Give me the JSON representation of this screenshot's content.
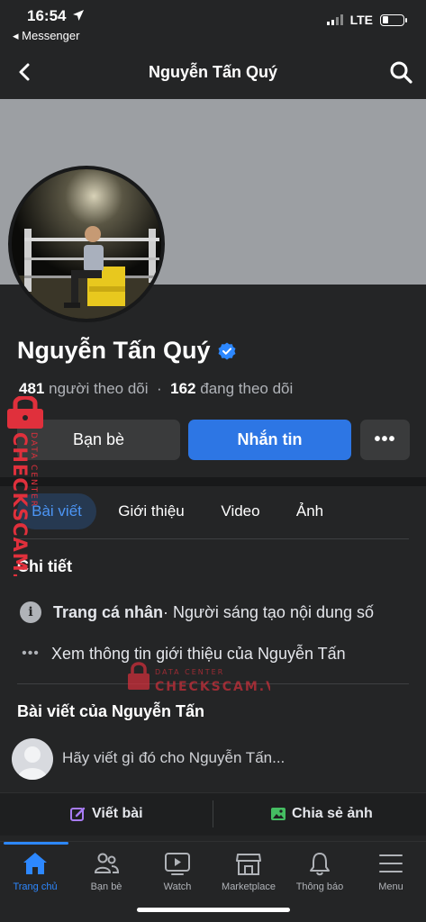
{
  "status_bar": {
    "time": "16:54",
    "back_app": "◂ Messenger",
    "network": "LTE"
  },
  "header": {
    "title": "Nguyễn Tấn Quý"
  },
  "profile": {
    "name": "Nguyễn Tấn Quý",
    "followers_count": "481",
    "followers_label": "người theo dõi",
    "separator": "·",
    "following_count": "162",
    "following_label": "đang theo dõi"
  },
  "buttons": {
    "friends": "Bạn bè",
    "message": "Nhắn tin",
    "more": "•••"
  },
  "tabs": [
    {
      "label": "Bài viết",
      "active": true
    },
    {
      "label": "Giới thiệu",
      "active": false
    },
    {
      "label": "Video",
      "active": false
    },
    {
      "label": "Ảnh",
      "active": false
    }
  ],
  "details": {
    "title": "Chi tiết",
    "page_type_bold": "Trang cá nhân",
    "page_type_rest": " · Người sáng tạo nội dung số",
    "see_about": "Xem thông tin giới thiệu của Nguyễn Tấn"
  },
  "posts": {
    "title": "Bài viết của Nguyễn Tấn",
    "composer_placeholder": "Hãy viết gì đó cho Nguyễn Tấn..."
  },
  "actions": {
    "write_post": "Viết bài",
    "share_photo": "Chia sẻ ảnh"
  },
  "bottom_nav": [
    {
      "label": "Trang chủ",
      "icon": "home-icon",
      "active": true
    },
    {
      "label": "Bạn bè",
      "icon": "friends-icon",
      "active": false
    },
    {
      "label": "Watch",
      "icon": "watch-icon",
      "active": false
    },
    {
      "label": "Marketplace",
      "icon": "marketplace-icon",
      "active": false
    },
    {
      "label": "Thông báo",
      "icon": "bell-icon",
      "active": false
    },
    {
      "label": "Menu",
      "icon": "menu-icon",
      "active": false
    }
  ],
  "watermark": {
    "side_small": "DATA CENTER",
    "side_big": "CHECKSCAM.VN",
    "mid_small": "DATA CENTER",
    "mid_big": "CHECKSCAM.VN"
  },
  "colors": {
    "background": "#242526",
    "accent": "#2d76e4",
    "cover": "#9c9fa3",
    "watermark": "#e0303c"
  }
}
